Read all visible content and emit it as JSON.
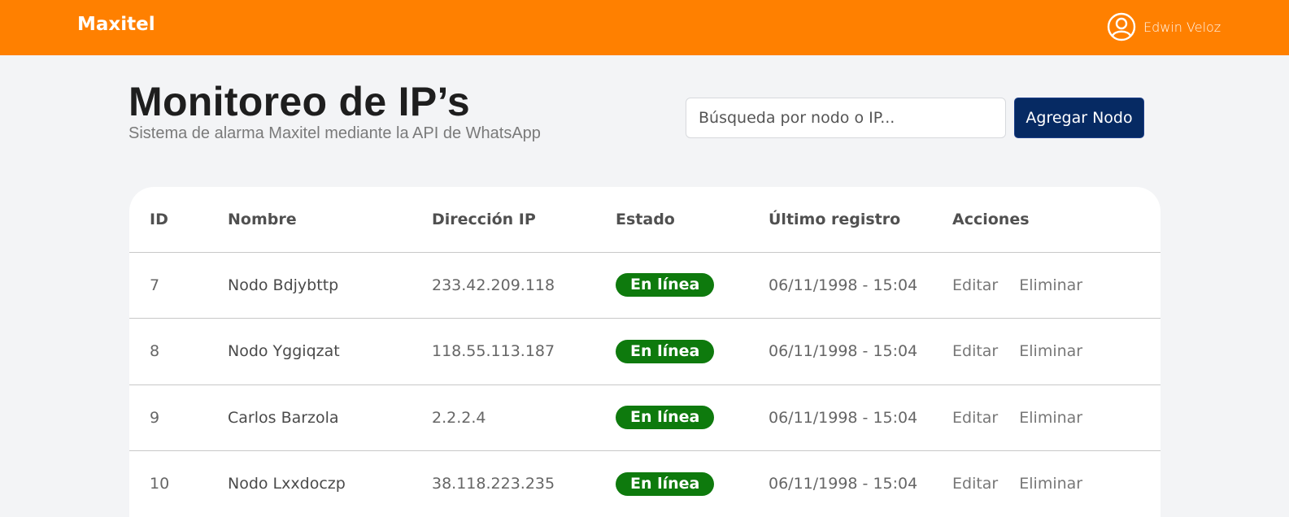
{
  "header": {
    "brand": "Maxitel",
    "user_name": "Edwin Veloz",
    "user_icon": "user-circle-icon"
  },
  "page": {
    "title": "Monitoreo de IP’s",
    "subtitle": "Sistema de alarma Maxitel mediante la API de WhatsApp"
  },
  "search": {
    "placeholder": "Búsqueda por nodo o IP..."
  },
  "add_button": {
    "label": "Agregar Nodo"
  },
  "colors": {
    "topbar": "#ff8000",
    "primary_button": "#062a63",
    "status_online": "#0e7a0d",
    "background": "#f3f4f6"
  },
  "table": {
    "headers": [
      "ID",
      "Nombre",
      "Dirección IP",
      "Estado",
      "Último registro",
      "Acciones"
    ],
    "rows": [
      {
        "id": "7",
        "name": "Nodo Bdjybttp",
        "ip": "233.42.209.118",
        "status": "En línea",
        "last": "06/11/1998 - 15:04",
        "edit": "Editar",
        "delete": "Eliminar"
      },
      {
        "id": "8",
        "name": "Nodo Yggiqzat",
        "ip": "118.55.113.187",
        "status": "En línea",
        "last": "06/11/1998 - 15:04",
        "edit": "Editar",
        "delete": "Eliminar"
      },
      {
        "id": "9",
        "name": "Carlos Barzola",
        "ip": "2.2.2.4",
        "status": "En línea",
        "last": "06/11/1998 - 15:04",
        "edit": "Editar",
        "delete": "Eliminar"
      },
      {
        "id": "10",
        "name": "Nodo Lxxdoczp",
        "ip": "38.118.223.235",
        "status": "En línea",
        "last": "06/11/1998 - 15:04",
        "edit": "Editar",
        "delete": "Eliminar"
      }
    ]
  }
}
